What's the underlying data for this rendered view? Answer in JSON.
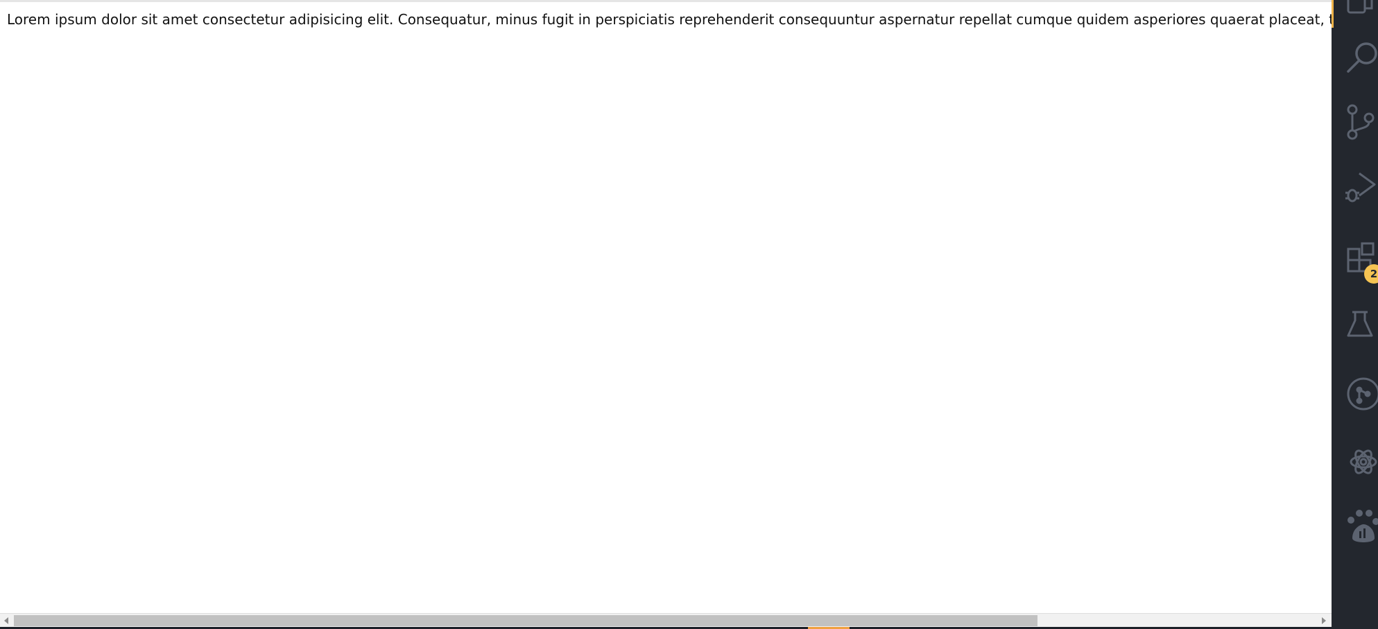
{
  "content": {
    "line": "Lorem ipsum dolor sit amet consectetur adipisicing elit. Consequatur, minus fugit in perspiciatis reprehenderit consequuntur aspernatur repellat cumque quidem asperiores quaerat placeat, tenetur vel"
  },
  "activity_bar": {
    "items": [
      {
        "icon": "explorer-icon"
      },
      {
        "icon": "search-icon"
      },
      {
        "icon": "source-control-icon"
      },
      {
        "icon": "run-debug-icon"
      },
      {
        "icon": "extensions-icon"
      },
      {
        "icon": "testing-icon"
      },
      {
        "icon": "git-graph-icon"
      },
      {
        "icon": "openai-icon"
      },
      {
        "icon": "paw-icon"
      }
    ],
    "extensions_badge": "2"
  },
  "colors": {
    "activity_bar_bg": "#23272e",
    "icon_color": "#5c6370",
    "badge_bg": "#f6c453",
    "accent": "#f0b44a"
  }
}
